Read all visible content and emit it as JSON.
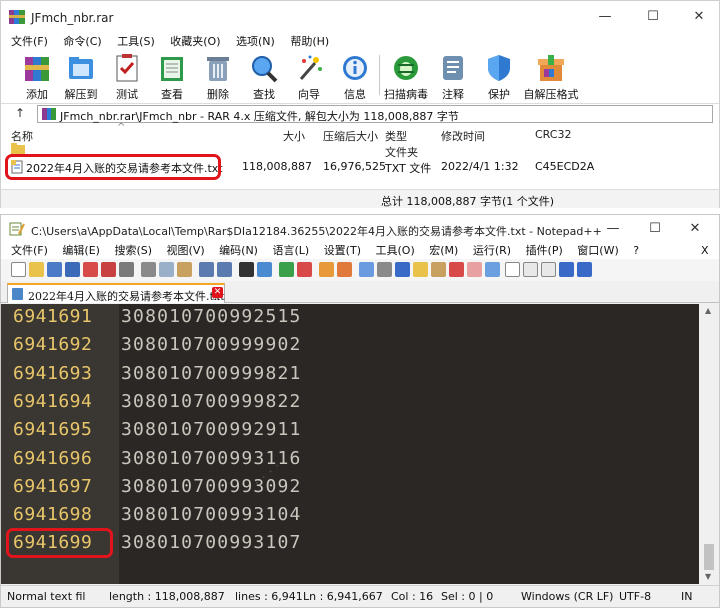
{
  "rar": {
    "title": "JFmch_nbr.rar",
    "menu": [
      "文件(F)",
      "命令(C)",
      "工具(S)",
      "收藏夹(O)",
      "选项(N)",
      "帮助(H)"
    ],
    "tools": [
      {
        "label": "添加",
        "icon": "add-books-icon"
      },
      {
        "label": "解压到",
        "icon": "extract-folder-icon"
      },
      {
        "label": "测试",
        "icon": "test-clipboard-icon"
      },
      {
        "label": "查看",
        "icon": "view-book-icon"
      },
      {
        "label": "删除",
        "icon": "trash-icon"
      },
      {
        "label": "查找",
        "icon": "magnifier-icon"
      },
      {
        "label": "向导",
        "icon": "magic-wand-icon"
      },
      {
        "label": "信息",
        "icon": "info-icon"
      },
      {
        "label": "扫描病毒",
        "icon": "virus-scan-icon"
      },
      {
        "label": "注释",
        "icon": "comment-icon"
      },
      {
        "label": "保护",
        "icon": "shield-icon"
      },
      {
        "label": "自解压格式",
        "icon": "sfx-box-icon"
      }
    ],
    "address": "JFmch_nbr.rar\\JFmch_nbr - RAR 4.x 压缩文件, 解包大小为 118,008,887 字节",
    "columns": {
      "name": "名称",
      "size": "大小",
      "packed": "压缩后大小",
      "type": "类型",
      "modified": "修改时间",
      "crc": "CRC32"
    },
    "parent_row": {
      "type": "文件夹"
    },
    "file": {
      "name": "2022年4月入账的交易请参考本文件.txt",
      "size": "118,008,887",
      "packed": "16,976,525",
      "type": "TXT 文件",
      "modified": "2022/4/1 1:32",
      "crc": "C45ECD2A"
    },
    "status": "总计 118,008,887 字节(1 个文件)"
  },
  "npp": {
    "title": "C:\\Users\\a\\AppData\\Local\\Temp\\Rar$DIa12184.36255\\2022年4月入账的交易请参考本文件.txt - Notepad++",
    "menu": [
      "文件(F)",
      "编辑(E)",
      "搜索(S)",
      "视图(V)",
      "编码(N)",
      "语言(L)",
      "设置(T)",
      "工具(O)",
      "宏(M)",
      "运行(R)",
      "插件(P)",
      "窗口(W)",
      "?"
    ],
    "tab_label": "2022年4月入账的交易请参考本文件.txt",
    "lines": [
      {
        "num": "6941691",
        "text": "308010700992515"
      },
      {
        "num": "6941692",
        "text": "308010700999902"
      },
      {
        "num": "6941693",
        "text": "308010700999821"
      },
      {
        "num": "6941694",
        "text": "308010700999822"
      },
      {
        "num": "6941695",
        "text": "308010700992911"
      },
      {
        "num": "6941696",
        "text": "308010700993116"
      },
      {
        "num": "6941697",
        "text": "308010700993092"
      },
      {
        "num": "6941698",
        "text": "308010700993104"
      },
      {
        "num": "6941699",
        "text": "308010700993107"
      }
    ],
    "status": {
      "type": "Normal text fil",
      "length": "length : 118,008,887",
      "lines": "lines : 6,941",
      "ln": "Ln : 6,941,667",
      "col": "Col : 16",
      "sel": "Sel : 0 | 0",
      "eol": "Windows (CR LF)",
      "encoding": "UTF-8",
      "ins": "IN"
    }
  },
  "colors": {
    "highlight": "#e0141a",
    "editor_bg": "#2a2724",
    "gutter_bg": "#3a3631",
    "line_number": "#e8c66a",
    "text": "#c9c6bd"
  }
}
